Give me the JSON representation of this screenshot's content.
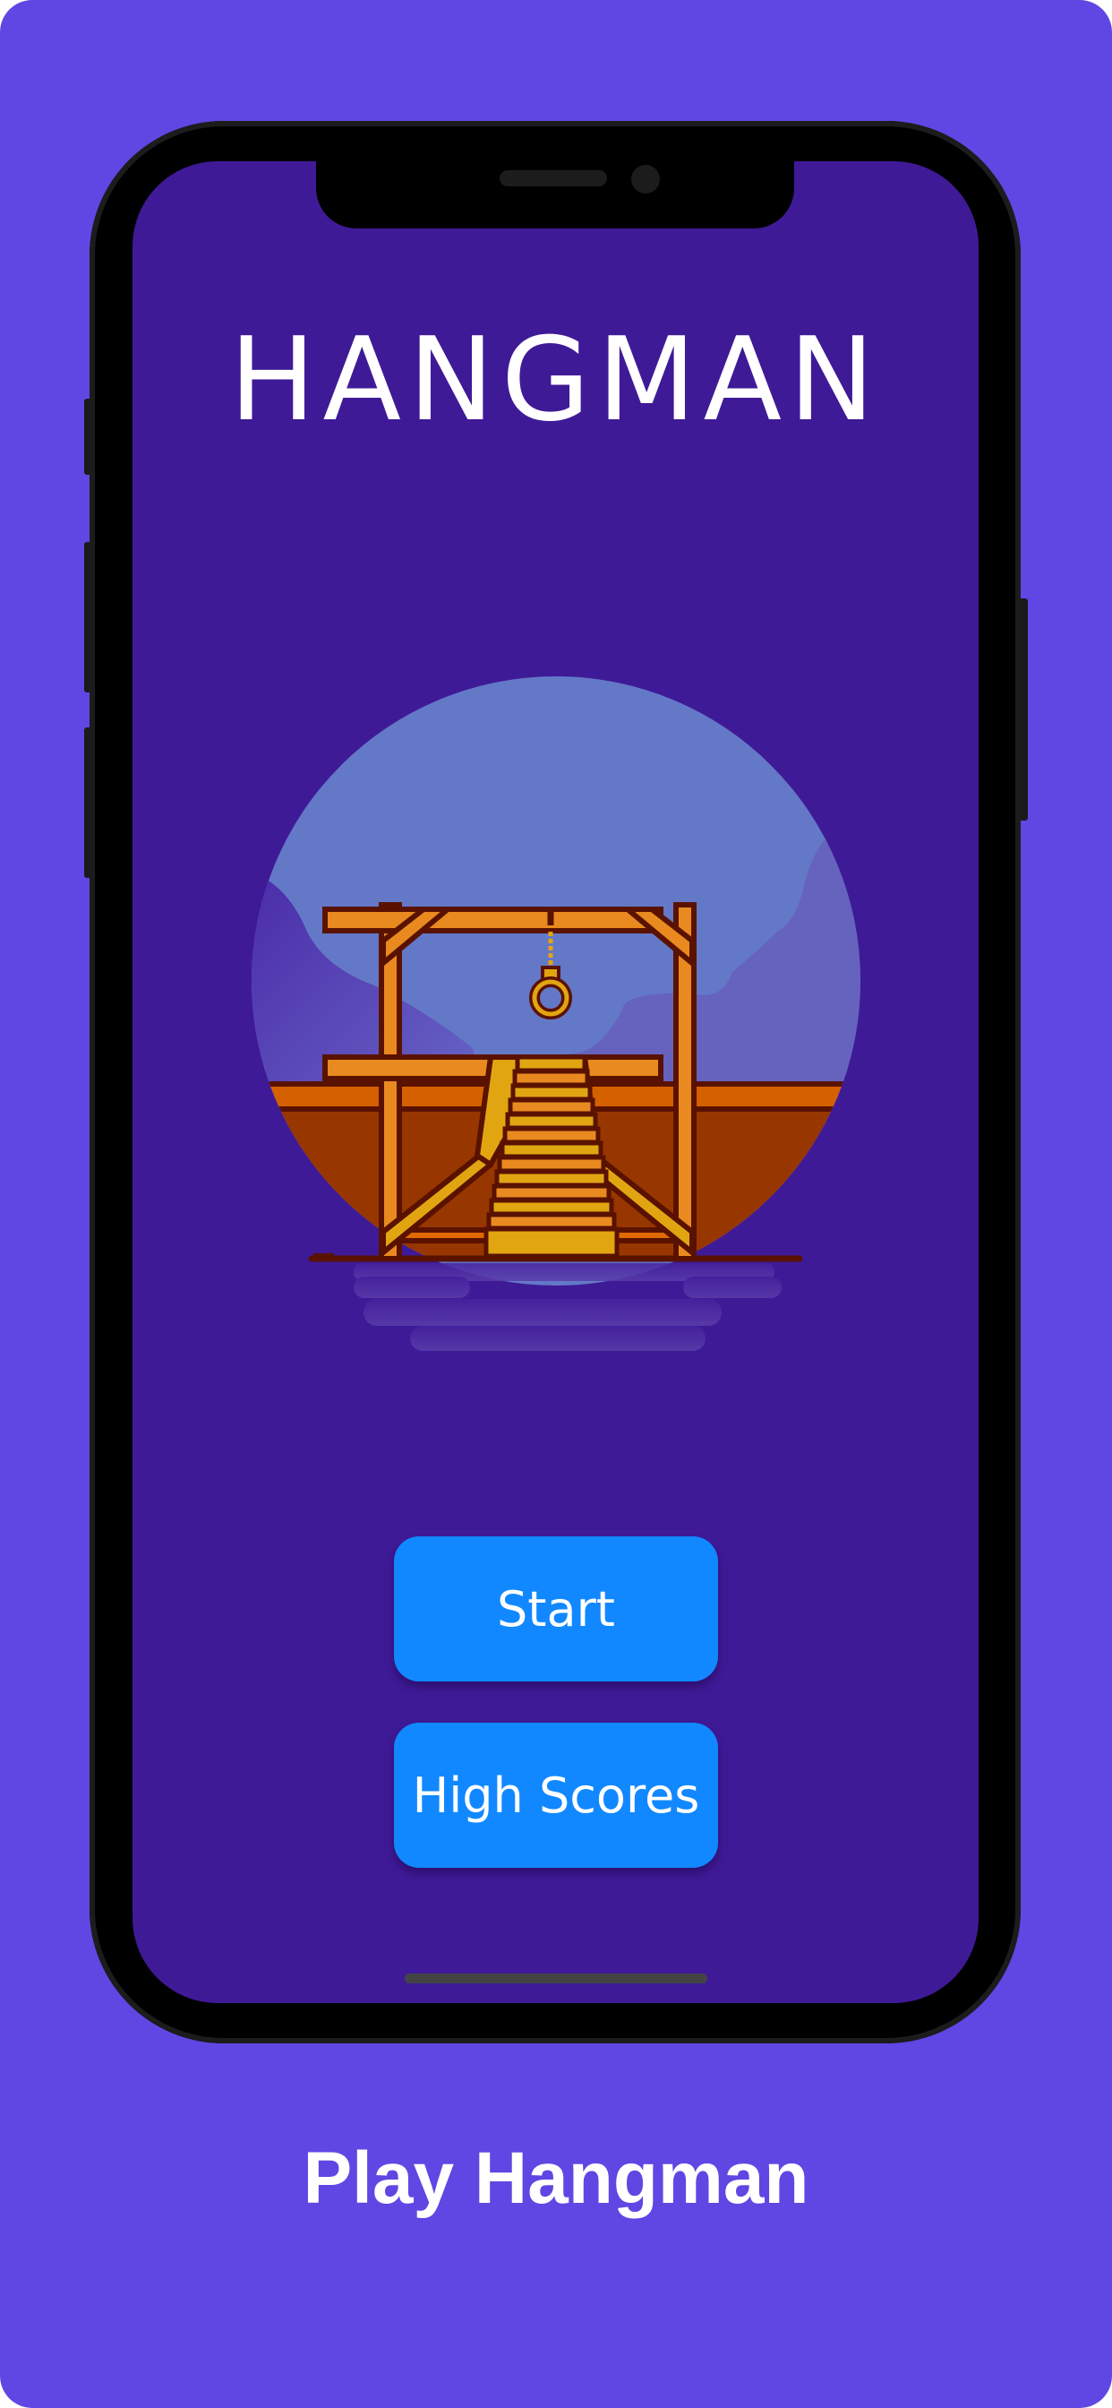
{
  "app": {
    "title": "HANGMAN"
  },
  "menu": {
    "start_label": "Start",
    "high_scores_label": "High Scores"
  },
  "caption": "Play Hangman",
  "colors": {
    "background": "#6047E3",
    "screen": "#3F1A97",
    "button": "#1188FF"
  },
  "illustration": "gallows-with-noose"
}
